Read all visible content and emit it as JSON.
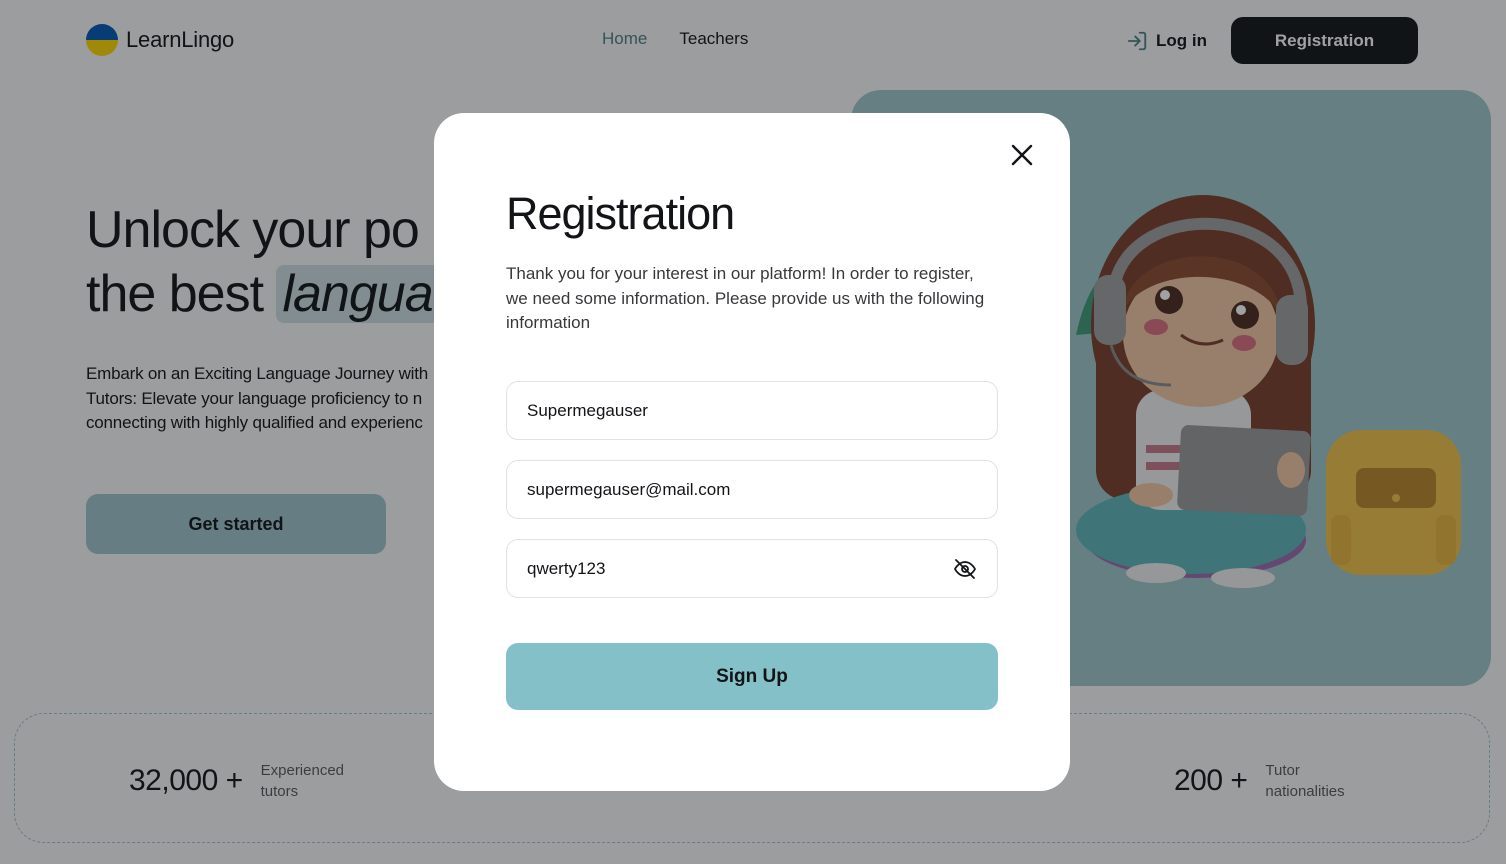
{
  "header": {
    "logo_text": "LearnLingo",
    "nav": [
      "Home",
      "Teachers"
    ],
    "login_label": "Log in",
    "registration_label": "Registration"
  },
  "hero": {
    "title_line1": "Unlock your po",
    "title_line2_plain": "the best ",
    "title_line2_highlight": "langua",
    "text_lines": [
      "Embark on an Exciting Language Journey with",
      "Tutors: Elevate your language proficiency to n",
      "connecting with highly qualified and experienc"
    ],
    "cta_label": "Get started"
  },
  "stats": [
    {
      "number": "32,000 +",
      "label": "Experienced tutors"
    },
    {
      "number": "200 +",
      "label": "Tutor nationalities"
    }
  ],
  "modal": {
    "title": "Registration",
    "description": "Thank you for your interest in our platform! In order to register, we need some information. Please provide us with the following information",
    "name_value": "Supermegauser",
    "email_value": "supermegauser@mail.com",
    "password_value": "qwerty123",
    "submit_label": "Sign Up"
  },
  "colors": {
    "accent": "#9fc6cb",
    "button_accent": "#84c0c8",
    "dark": "#121417",
    "overlay": "rgba(18,20,23,0.4)"
  },
  "icons": {
    "login": "login-arrow-icon",
    "close": "close-icon",
    "password_toggle": "eye-off-icon"
  }
}
